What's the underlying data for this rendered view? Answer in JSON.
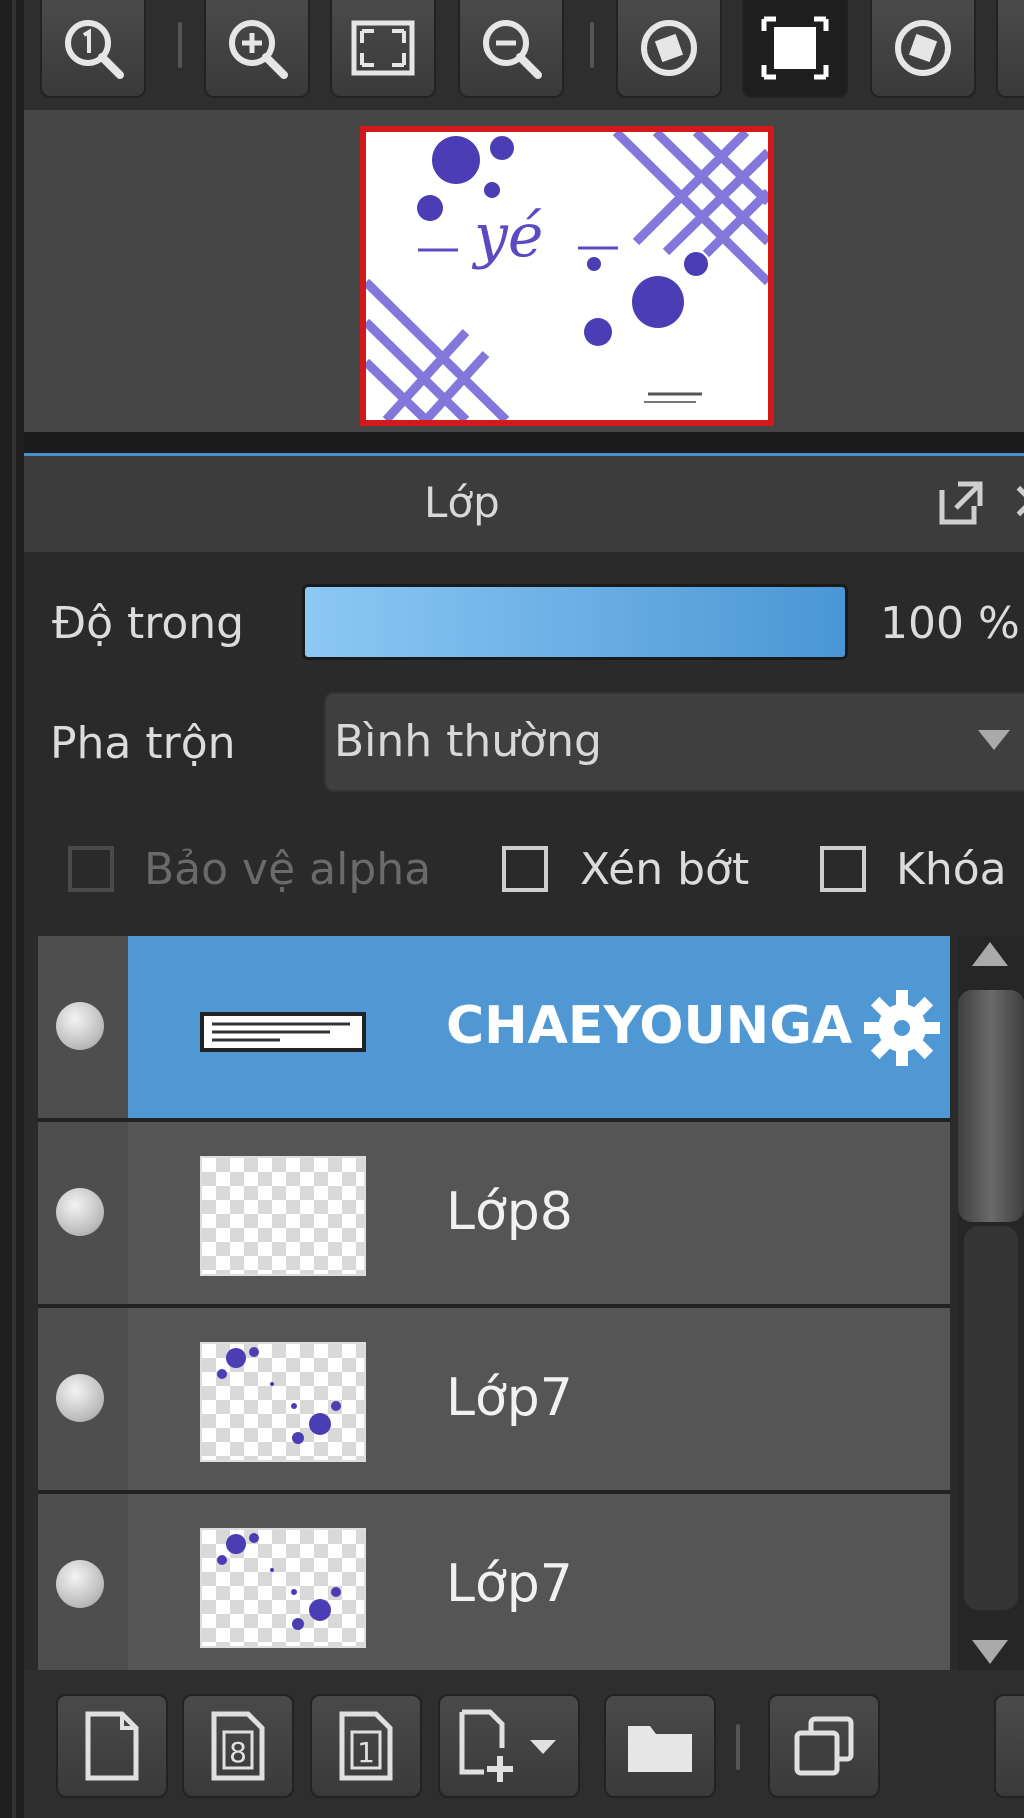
{
  "colors": {
    "accent": "#4f98d4",
    "navigator_frame": "#d21a1a",
    "art_purple": "#5a4bc0"
  },
  "navigator": {
    "canvas_text": "yé"
  },
  "layer_panel": {
    "title": "Lớp",
    "opacity": {
      "label": "Độ trong",
      "value_text": "100 %",
      "value": 1.0
    },
    "blend": {
      "label": "Pha trộn",
      "selected": "Bình thường"
    },
    "options": [
      {
        "label": "Bảo vệ alpha",
        "checked": false,
        "enabled": false
      },
      {
        "label": "Xén bớt",
        "checked": false,
        "enabled": true
      },
      {
        "label": "Khóa",
        "checked": false,
        "enabled": true
      }
    ],
    "layers": [
      {
        "name": "CHAEYOUNGA",
        "selected": true,
        "thumbnail": "text-strip",
        "has_settings_icon": true
      },
      {
        "name": "Lớp8",
        "selected": false,
        "thumbnail": "empty"
      },
      {
        "name": "Lớp7",
        "selected": false,
        "thumbnail": "dots"
      },
      {
        "name": "Lớp7",
        "selected": false,
        "thumbnail": "dots"
      }
    ]
  },
  "top_toolbar": {
    "icons": [
      "zoom-actual-icon",
      "zoom-in-icon",
      "fit-screen-icon",
      "zoom-out-icon",
      "rotate-left-icon",
      "reset-view-icon",
      "rotate-right-icon"
    ]
  },
  "bottom_toolbar": {
    "icons": [
      "new-layer-icon",
      "new-8bit-layer-icon",
      "new-1bit-layer-icon",
      "add-layer-menu-icon",
      "new-folder-icon",
      "duplicate-layer-icon"
    ]
  }
}
